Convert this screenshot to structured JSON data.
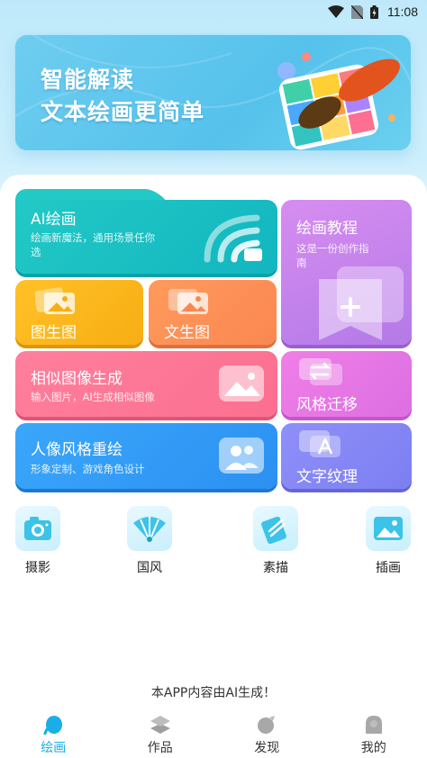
{
  "status_bar": {
    "time": "11:08",
    "icons": [
      "wifi-icon",
      "no-sim-icon",
      "battery-icon"
    ]
  },
  "banner": {
    "line1": "智能解读",
    "line2": "文本绘画更简单"
  },
  "cards": {
    "ai_painting": {
      "title": "AI绘画",
      "subtitle": "绘画新魔法，通用场景任你选"
    },
    "tutorial": {
      "title": "绘画教程",
      "subtitle": "这是一份创作指南"
    },
    "img2img": {
      "title": "图生图"
    },
    "txt2img": {
      "title": "文生图"
    },
    "similar": {
      "title": "相似图像生成",
      "subtitle": "输入图片，AI生成相似图像"
    },
    "style_transfer": {
      "title": "风格迁移"
    },
    "portrait": {
      "title": "人像风格重绘",
      "subtitle": "形象定制、游戏角色设计"
    },
    "text_texture": {
      "title": "文字纹理"
    }
  },
  "tools": [
    {
      "label": "摄影",
      "icon": "camera-icon"
    },
    {
      "label": "国风",
      "icon": "fan-icon"
    },
    {
      "label": "素描",
      "icon": "pencil-icon"
    },
    {
      "label": "插画",
      "icon": "picture-icon"
    }
  ],
  "notice": "本APP内容由AI生成！",
  "nav": [
    {
      "label": "绘画",
      "icon": "paint-drop-icon",
      "active": true
    },
    {
      "label": "作品",
      "icon": "layers-icon",
      "active": false
    },
    {
      "label": "发现",
      "icon": "discover-icon",
      "active": false
    },
    {
      "label": "我的",
      "icon": "profile-icon",
      "active": false
    }
  ],
  "colors": {
    "accent": "#1aaee8",
    "ai_card": "#22c9c5",
    "tutorial_card": "#c684ee",
    "img2img_card": "#ffb91f",
    "txt2img_card": "#fd9158",
    "similar_card": "#fd7896",
    "style_card": "#e777e4",
    "portrait_card": "#339cf6",
    "texture_card": "#8687f5"
  }
}
